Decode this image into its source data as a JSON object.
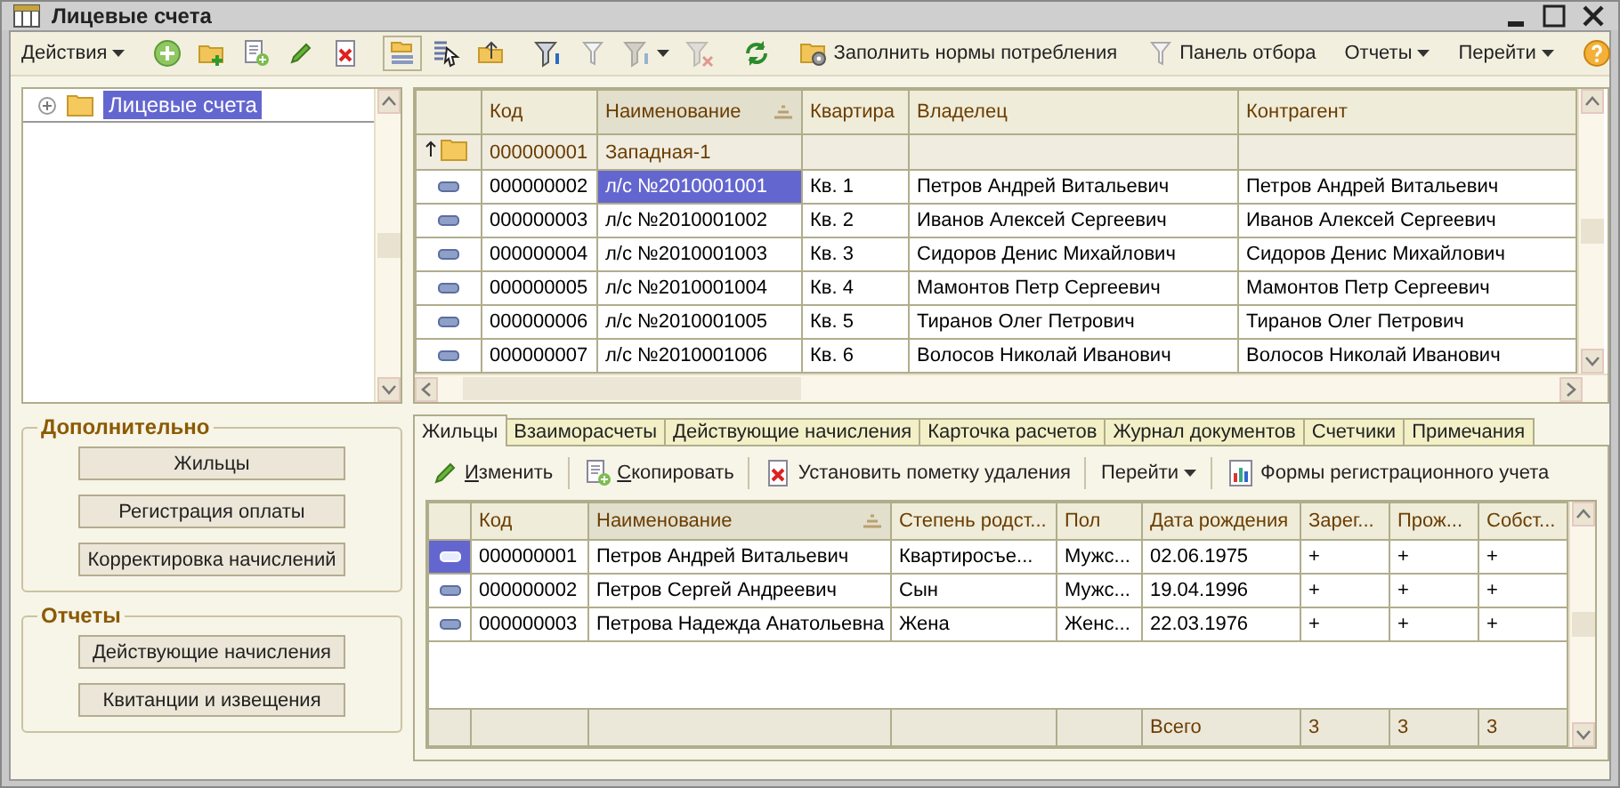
{
  "window": {
    "title": "Лицевые счета"
  },
  "toolbar": {
    "actions_menu": "Действия",
    "fill_norms": "Заполнить нормы потребления",
    "filter_panel": "Панель отбора",
    "reports_menu": "Отчеты",
    "goto_menu": "Перейти"
  },
  "tree": {
    "items": [
      {
        "label": "Лицевые счета",
        "selected": true,
        "expanded": false
      }
    ]
  },
  "accounts_table": {
    "columns": [
      {
        "label": "Код",
        "sorted": false
      },
      {
        "label": "Наименование",
        "sorted": true
      },
      {
        "label": "Квартира",
        "sorted": false
      },
      {
        "label": "Владелец",
        "sorted": false
      },
      {
        "label": "Контрагент",
        "sorted": false
      }
    ],
    "rows": [
      {
        "kind": "group",
        "code": "000000001",
        "name": "Западная-1",
        "selected": false
      },
      {
        "kind": "item",
        "code": "000000002",
        "name": "л/с №2010001001",
        "apartment": "Кв. 1",
        "owner": "Петров Андрей Витальевич",
        "counterparty": "Петров Андрей Витальевич",
        "selected": true
      },
      {
        "kind": "item",
        "code": "000000003",
        "name": "л/с №2010001002",
        "apartment": "Кв. 2",
        "owner": "Иванов Алексей Сергеевич",
        "counterparty": "Иванов Алексей Сергеевич",
        "selected": false
      },
      {
        "kind": "item",
        "code": "000000004",
        "name": "л/с №2010001003",
        "apartment": "Кв. 3",
        "owner": "Сидоров Денис Михайлович",
        "counterparty": "Сидоров Денис Михайлович",
        "selected": false
      },
      {
        "kind": "item",
        "code": "000000005",
        "name": "л/с №2010001004",
        "apartment": "Кв. 4",
        "owner": "Мамонтов Петр Сергеевич",
        "counterparty": "Мамонтов Петр Сергеевич",
        "selected": false
      },
      {
        "kind": "item",
        "code": "000000006",
        "name": "л/с №2010001005",
        "apartment": "Кв. 5",
        "owner": "Тиранов Олег Петрович",
        "counterparty": "Тиранов Олег Петрович",
        "selected": false
      },
      {
        "kind": "item",
        "code": "000000007",
        "name": "л/с №2010001006",
        "apartment": "Кв. 6",
        "owner": "Волосов Николай Иванович",
        "counterparty": "Волосов Николай Иванович",
        "selected": false
      }
    ]
  },
  "side_groups": [
    {
      "title": "Дополнительно",
      "buttons": [
        "Жильцы",
        "Регистрация оплаты",
        "Корректировка начислений"
      ]
    },
    {
      "title": "Отчеты",
      "buttons": [
        "Действующие начисления",
        "Квитанции и извещения"
      ]
    }
  ],
  "tabs": [
    {
      "label": "Жильцы",
      "selected": true
    },
    {
      "label": "Взаиморасчеты",
      "selected": false
    },
    {
      "label": "Действующие начисления",
      "selected": false
    },
    {
      "label": "Карточка расчетов",
      "selected": false
    },
    {
      "label": "Журнал документов",
      "selected": false
    },
    {
      "label": "Счетчики",
      "selected": false
    },
    {
      "label": "Примечания",
      "selected": false
    }
  ],
  "residents_toolbar": {
    "edit": "Изменить",
    "copy": "Скопировать",
    "mark_delete": "Установить пометку удаления",
    "goto_menu": "Перейти",
    "reg_forms": "Формы регистрационного учета"
  },
  "residents_table": {
    "columns": [
      {
        "label": "Код",
        "sorted": false
      },
      {
        "label": "Наименование",
        "sorted": true
      },
      {
        "label": "Степень родст...",
        "sorted": false
      },
      {
        "label": "Пол",
        "sorted": false
      },
      {
        "label": "Дата рождения",
        "sorted": false
      },
      {
        "label": "Зарег...",
        "sorted": false
      },
      {
        "label": "Прож...",
        "sorted": false
      },
      {
        "label": "Собст...",
        "sorted": false
      }
    ],
    "rows": [
      {
        "code": "000000001",
        "name": "Петров Андрей Витальевич",
        "relation": "Квартиросъе...",
        "sex": "Мужс...",
        "birth_date": "02.06.1975",
        "registered": "+",
        "living": "+",
        "owner": "+",
        "selected": true
      },
      {
        "code": "000000002",
        "name": "Петров Сергей Андреевич",
        "relation": "Сын",
        "sex": "Мужс...",
        "birth_date": "19.04.1996",
        "registered": "+",
        "living": "+",
        "owner": "+",
        "selected": false
      },
      {
        "code": "000000003",
        "name": "Петрова Надежда Анатольевна",
        "relation": "Жена",
        "sex": "Женс...",
        "birth_date": "22.03.1976",
        "registered": "+",
        "living": "+",
        "owner": "+",
        "selected": false
      }
    ],
    "footer": {
      "label": "Всего",
      "values": [
        "3",
        "3",
        "3"
      ]
    }
  }
}
